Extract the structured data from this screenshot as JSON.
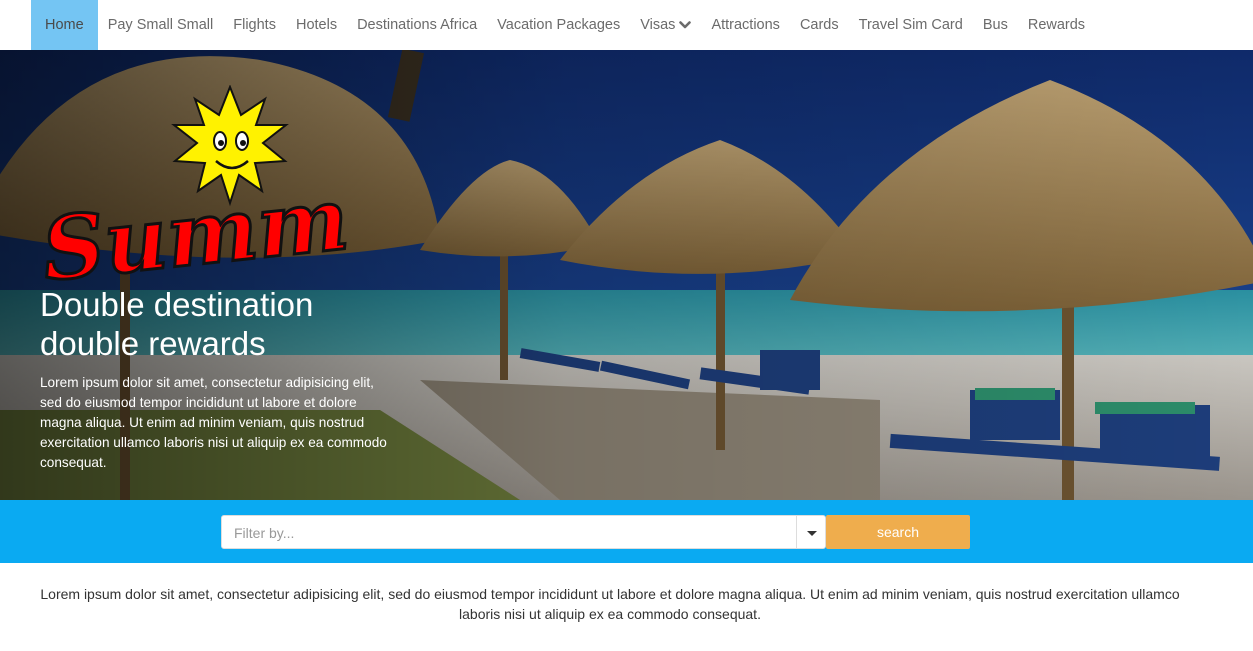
{
  "nav": {
    "items": [
      {
        "label": "Home",
        "active": true
      },
      {
        "label": "Pay Small Small"
      },
      {
        "label": "Flights"
      },
      {
        "label": "Hotels"
      },
      {
        "label": "Destinations Africa"
      },
      {
        "label": "Vacation Packages"
      },
      {
        "label": "Visas",
        "dropdown": true
      },
      {
        "label": "Attractions"
      },
      {
        "label": "Cards"
      },
      {
        "label": "Travel Sim Card"
      },
      {
        "label": "Bus"
      },
      {
        "label": "Rewards"
      }
    ],
    "active_color": "#74c5f3"
  },
  "hero": {
    "logo_text": "Summer",
    "title_line1": "Double destination",
    "title_line2": "double rewards",
    "text": "Lorem ipsum dolor sit amet, consectetur adipisicing elit, sed do eiusmod tempor incididunt ut labore et dolore magna aliqua. Ut enim ad minim veniam, quis nostrud exercitation ullamco laboris nisi ut aliquip ex ea commodo consequat."
  },
  "search": {
    "placeholder": "Filter by...",
    "button_label": "search",
    "band_color": "#0aaaf2",
    "button_color": "#efad4d"
  },
  "intro": {
    "text": "Lorem ipsum dolor sit amet, consectetur adipisicing elit, sed do eiusmod tempor incididunt ut labore et dolore magna aliqua. Ut enim ad minim veniam, quis nostrud exercitation ullamco laboris nisi ut aliquip ex ea commodo consequat."
  }
}
